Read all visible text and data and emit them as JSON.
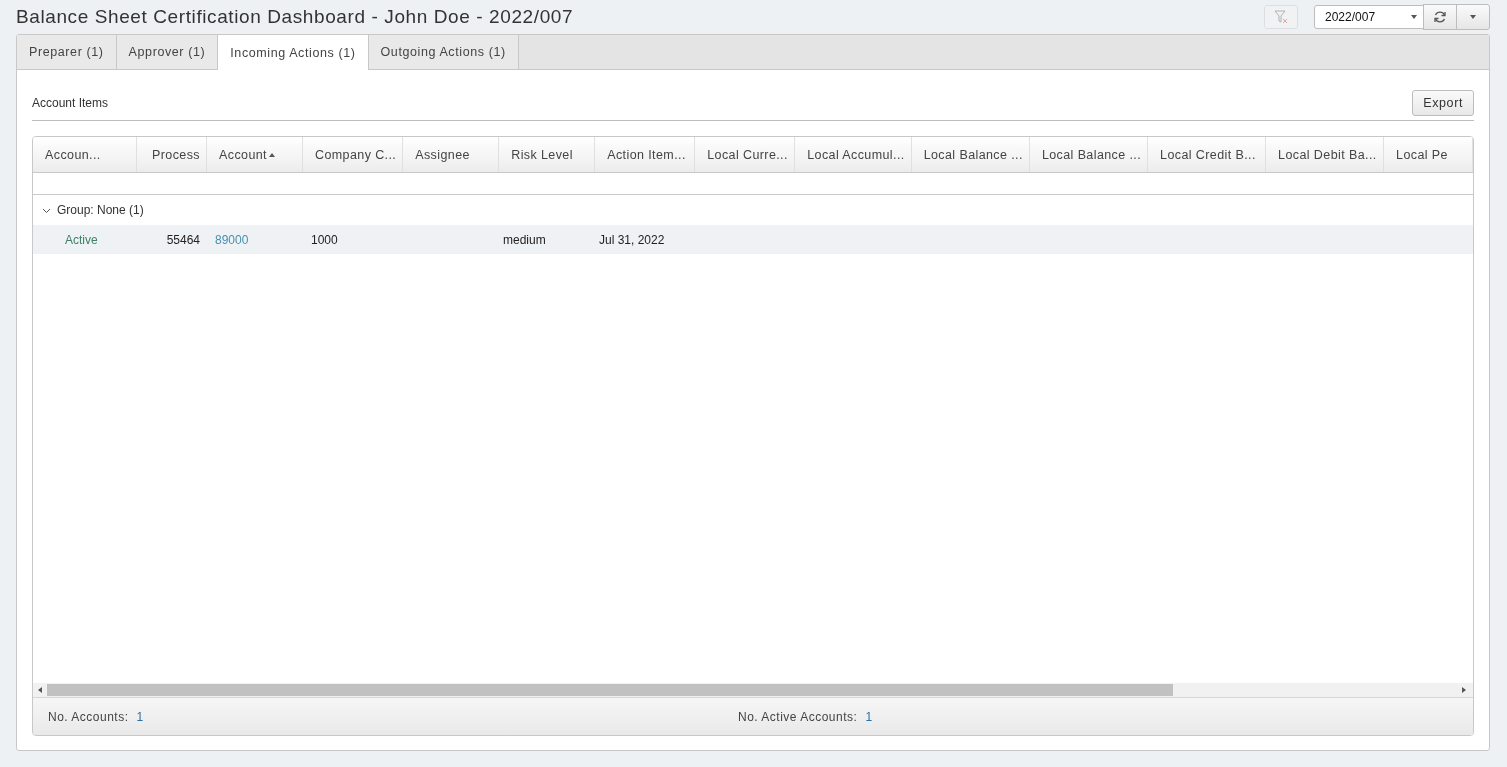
{
  "window": {
    "title": "Balance Sheet Certification Dashboard - John Doe - 2022/007"
  },
  "toolbar": {
    "period": "2022/007",
    "filter_disabled": true
  },
  "tabs": [
    {
      "label": "Preparer (1)",
      "selected": false
    },
    {
      "label": "Approver (1)",
      "selected": false
    },
    {
      "label": "Incoming Actions (1)",
      "selected": true
    },
    {
      "label": "Outgoing Actions (1)",
      "selected": false
    }
  ],
  "section": {
    "title": "Account Items",
    "export": "Export"
  },
  "table": {
    "columns": [
      {
        "label": "Accoun...",
        "sorted": false
      },
      {
        "label": "Process",
        "sorted": false
      },
      {
        "label": "Account",
        "sorted": true
      },
      {
        "label": "Company C...",
        "sorted": false
      },
      {
        "label": "Assignee",
        "sorted": false
      },
      {
        "label": "Risk Level",
        "sorted": false
      },
      {
        "label": "Action Item...",
        "sorted": false
      },
      {
        "label": "Local Curre...",
        "sorted": false
      },
      {
        "label": "Local Accumul...",
        "sorted": false
      },
      {
        "label": "Local Balance ...",
        "sorted": false
      },
      {
        "label": "Local Balance ...",
        "sorted": false
      },
      {
        "label": "Local Credit B...",
        "sorted": false
      },
      {
        "label": "Local Debit Ba...",
        "sorted": false
      },
      {
        "label": "Local Pe",
        "sorted": false
      }
    ],
    "group": {
      "label": "Group: None (1)",
      "expanded": true
    },
    "rows": [
      {
        "selected": true,
        "cells": [
          {
            "text": "Active",
            "kind": "status"
          },
          {
            "text": "55464",
            "kind": "text"
          },
          {
            "text": "89000",
            "kind": "link"
          },
          {
            "text": "1000",
            "kind": "text"
          },
          {
            "kind": "empty"
          },
          {
            "text": "medium",
            "kind": "text"
          },
          {
            "text": "Jul 31, 2022",
            "kind": "text"
          }
        ]
      }
    ]
  },
  "footer": [
    {
      "label": "No. Accounts:",
      "value": "1"
    },
    {
      "label": "No. Active Accounts:",
      "value": "1"
    }
  ]
}
